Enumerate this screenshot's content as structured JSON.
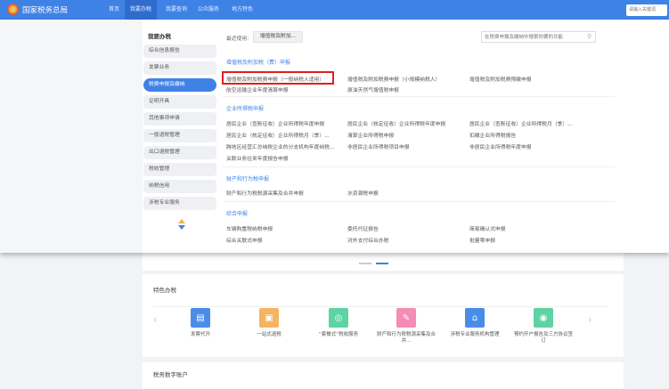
{
  "header": {
    "site_title": "国家税务总局",
    "nav": [
      "首页",
      "我要办税",
      "我要查询",
      "公众服务",
      "地方特色"
    ],
    "active_nav": 1,
    "search_placeholder": "请输入关键词"
  },
  "sidebar": {
    "title": "我要办税",
    "items": [
      "综合信息报告",
      "发票业务",
      "税费申报及缴纳",
      "证明开具",
      "其他事项申请",
      "一般退税管理",
      "出口退税管理",
      "税收管理",
      "纳税信用",
      "涉税专业服务"
    ],
    "active": 2
  },
  "content": {
    "recent_label": "最近使用:",
    "recent_button": "增值税及附加...",
    "search_placeholder": "在税费申报及缴纳中搜索你要的功能",
    "sections": [
      {
        "title": "增值税及附加税（费）申报",
        "items": [
          "增值税及附加税费申报（一般纳税人适用）",
          "增值税及附加税费申报（小规模纳税人）",
          "增值税及附加税费预缴申报",
          "航空运输企业年度清算申报",
          "原油天然气增值税申报"
        ]
      },
      {
        "title": "企业所得税申报",
        "items": [
          "居民企业（查账征收）企业所得税年度申报",
          "居民企业（核定征收）企业所得税年度申报",
          "居民企业（查账征收）企业所得税月（季）...",
          "居民企业（核定征收）企业所得税月（季）...",
          "清算企业所得税申报",
          "扣缴企业所得税报告",
          "跨地区经营汇总纳税企业的分支机构年度纳税...",
          "非居民企业所得税项目申报",
          "非居民企业所得税年度申报",
          "关联业务往来年度报告申报"
        ]
      },
      {
        "title": "财产和行为税申报",
        "items": [
          "财产和行为税税源采集及合并申报",
          "水资源税申报"
        ]
      },
      {
        "title": "综合申报",
        "items": [
          "车辆购置税纳税申报",
          "委托代征报告",
          "简易确认式申报",
          "综合关联式申报",
          "对外支付综合办税",
          "批量零申报"
        ]
      }
    ]
  },
  "services": {
    "title": "特色办税",
    "items": [
      {
        "label": "发票代开",
        "icon": "invoice-icon",
        "color": "#4a8de8"
      },
      {
        "label": "一站式退税",
        "icon": "refund-icon",
        "color": "#f5b461"
      },
      {
        "label": "“套餐式”税收服务",
        "icon": "package-icon",
        "color": "#5fd3a3"
      },
      {
        "label": "财产和行为税税源采集及合并...",
        "icon": "property-icon",
        "color": "#f48cb6"
      },
      {
        "label": "涉税专业服务机构管理",
        "icon": "agency-icon",
        "color": "#4a8de8"
      },
      {
        "label": "预约开户报告及三方协议签订",
        "icon": "account-icon",
        "color": "#5fd3a3"
      }
    ]
  },
  "account": {
    "title": "税务数字账户"
  }
}
